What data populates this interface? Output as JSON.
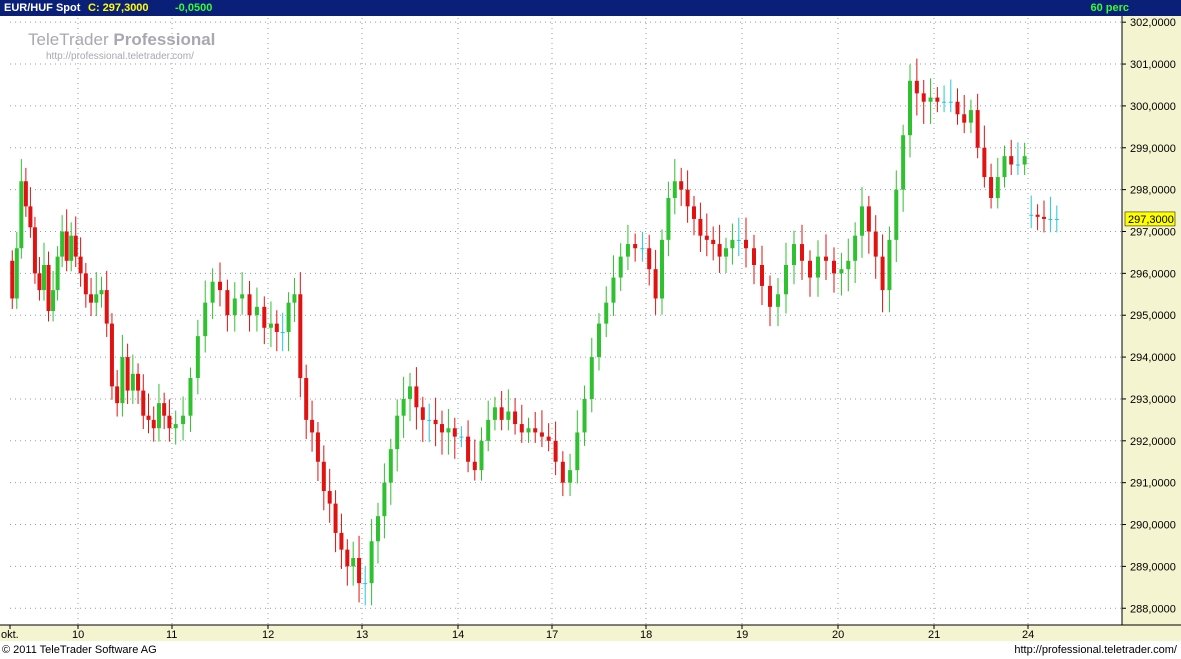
{
  "header": {
    "symbol": "EUR/HUF Spot",
    "price_label": "C: 297,3000",
    "change": "-0,0500",
    "interval": "60 perc"
  },
  "watermark": {
    "brand_plain": "TeleTrader ",
    "brand_bold": "Professional",
    "url": "http://professional.teletrader.com/"
  },
  "footer": {
    "copyright": "© 2011 TeleTrader Software AG",
    "site": "http://professional.teletrader.com/"
  },
  "colors": {
    "up": "#2fc12f",
    "down": "#e01212",
    "flat": "#22c8d8",
    "grid": "#9a9a9a",
    "axis_bg": "#f4f4d0",
    "last_price_bg": "#ffff00",
    "header_bg": "#0a1f78"
  },
  "chart_data": {
    "type": "candlestick",
    "y_ticks": [
      "288,0000",
      "289,0000",
      "290,0000",
      "291,0000",
      "292,0000",
      "293,0000",
      "294,0000",
      "295,0000",
      "296,0000",
      "297,0000",
      "298,0000",
      "299,0000",
      "300,0000",
      "301,0000",
      "302,0000"
    ],
    "ylim": [
      287.6,
      302.1
    ],
    "x_ticks": [
      "okt.",
      "10",
      "11",
      "12",
      "13",
      "14",
      "17",
      "18",
      "19",
      "20",
      "21",
      "24"
    ],
    "last_price": 297.3,
    "last_price_label": "297,3000",
    "grid": true,
    "segments": [
      {
        "day": "okt.",
        "points": [
          296.3,
          295.4,
          296.6,
          298.2,
          297.6,
          297.1,
          296.0,
          295.6,
          296.2,
          295.1,
          295.6,
          296.4,
          297.0,
          296.3,
          296.9,
          296.4
        ]
      },
      {
        "day": "10",
        "points": [
          296.4,
          296.0,
          295.5,
          295.3,
          295.5,
          295.6,
          294.8,
          293.3,
          292.9,
          294.0,
          293.2,
          293.6,
          293.2,
          292.6,
          292.5,
          292.3,
          292.9,
          292.6,
          292.3
        ]
      },
      {
        "day": "11",
        "points": [
          292.3,
          292.4,
          292.6,
          293.5,
          294.5,
          295.3,
          295.8,
          295.6,
          295.0,
          295.4,
          295.5,
          295.0,
          295.2,
          294.7
        ]
      },
      {
        "day": "12",
        "points": [
          294.7,
          294.8,
          294.6,
          294.6,
          295.3,
          295.5,
          293.5,
          292.5,
          292.2,
          291.5,
          290.8,
          290.5,
          289.8,
          289.4,
          289.0,
          289.2,
          288.6
        ]
      },
      {
        "day": "13",
        "points": [
          288.6,
          288.6,
          289.6,
          290.2,
          291.0,
          291.8,
          292.6,
          293.0,
          293.3,
          292.8,
          292.5,
          292.5,
          292.4,
          292.2,
          292.3,
          292.1
        ]
      },
      {
        "day": "14",
        "points": [
          292.1,
          292.1,
          291.5,
          291.3,
          292.0,
          292.5,
          292.8,
          292.5,
          292.7,
          292.4,
          292.2,
          292.3,
          292.2,
          292.1,
          292.0
        ]
      },
      {
        "day": "17",
        "points": [
          292.0,
          291.5,
          291.0,
          291.3,
          292.2,
          293.0,
          294.0,
          294.8,
          295.3,
          295.9,
          296.4,
          296.7,
          296.6,
          296.6
        ]
      },
      {
        "day": "18",
        "points": [
          296.6,
          296.1,
          295.4,
          296.8,
          297.8,
          298.2,
          298.0,
          297.6,
          297.3,
          296.9,
          296.8,
          296.7,
          296.4,
          296.6,
          296.8,
          296.8
        ]
      },
      {
        "day": "19",
        "points": [
          296.8,
          296.6,
          296.2,
          295.7,
          295.2,
          295.5,
          296.2,
          296.7,
          296.3,
          295.9,
          296.4,
          296.3,
          296.0
        ]
      },
      {
        "day": "20",
        "points": [
          296.0,
          296.1,
          296.3,
          296.9,
          297.6,
          297.0,
          296.4,
          295.6,
          296.8,
          298.0,
          299.3,
          300.6,
          300.3,
          300.1,
          300.2
        ]
      },
      {
        "day": "21",
        "points": [
          300.2,
          300.1,
          300.1,
          300.1,
          299.8,
          299.6,
          299.9,
          299.0,
          298.3,
          297.8,
          298.3,
          298.8,
          298.6,
          298.6,
          298.8
        ]
      },
      {
        "day": "24",
        "points": [
          297.4,
          297.4,
          297.35,
          297.3,
          297.3,
          297.3
        ]
      }
    ]
  }
}
